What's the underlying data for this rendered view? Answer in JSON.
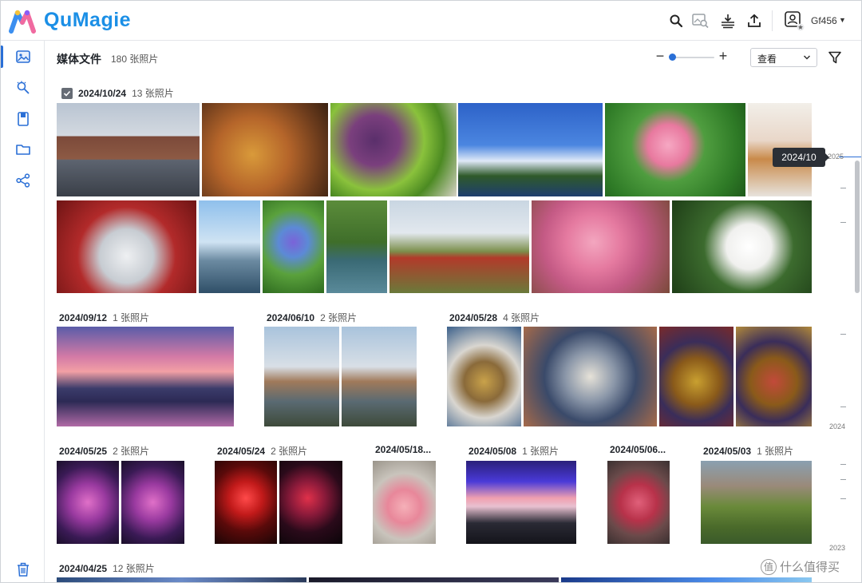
{
  "app": {
    "name": "QuMagie",
    "username": "Gf456"
  },
  "header": {
    "title": "媒体文件",
    "count": "180 张照片",
    "zoom_level": 0.05,
    "view_select": "查看"
  },
  "sidebar": {
    "items": [
      {
        "icon": "photos-icon",
        "active": true
      },
      {
        "icon": "magic-wand-icon",
        "active": false
      },
      {
        "icon": "album-icon",
        "active": false
      },
      {
        "icon": "folder-icon",
        "active": false
      },
      {
        "icon": "share-icon",
        "active": false
      },
      {
        "icon": "trash-icon",
        "active": false
      }
    ]
  },
  "groups": [
    {
      "date": "2024/10/24",
      "count": "13 张照片",
      "selected": true
    },
    {
      "date": "2024/09/12",
      "count": "1 张照片"
    },
    {
      "date": "2024/06/10",
      "count": "2 张照片"
    },
    {
      "date": "2024/05/28",
      "count": "4 张照片"
    },
    {
      "date": "2024/05/25",
      "count": "2 张照片"
    },
    {
      "date": "2024/05/24",
      "count": "2 张照片"
    },
    {
      "date": "2024/05/18...",
      "count": ""
    },
    {
      "date": "2024/05/08",
      "count": "1 张照片"
    },
    {
      "date": "2024/05/06...",
      "count": ""
    },
    {
      "date": "2024/05/03",
      "count": "1 张照片"
    },
    {
      "date": "2024/04/25",
      "count": "12 张照片"
    }
  ],
  "timeline": {
    "tooltip": "2024/10",
    "years": [
      "2025",
      "2024",
      "2023"
    ]
  },
  "watermark": "什么值得买",
  "colors": {
    "accent": "#2a6fd6",
    "brand": "#1b8fe6"
  }
}
